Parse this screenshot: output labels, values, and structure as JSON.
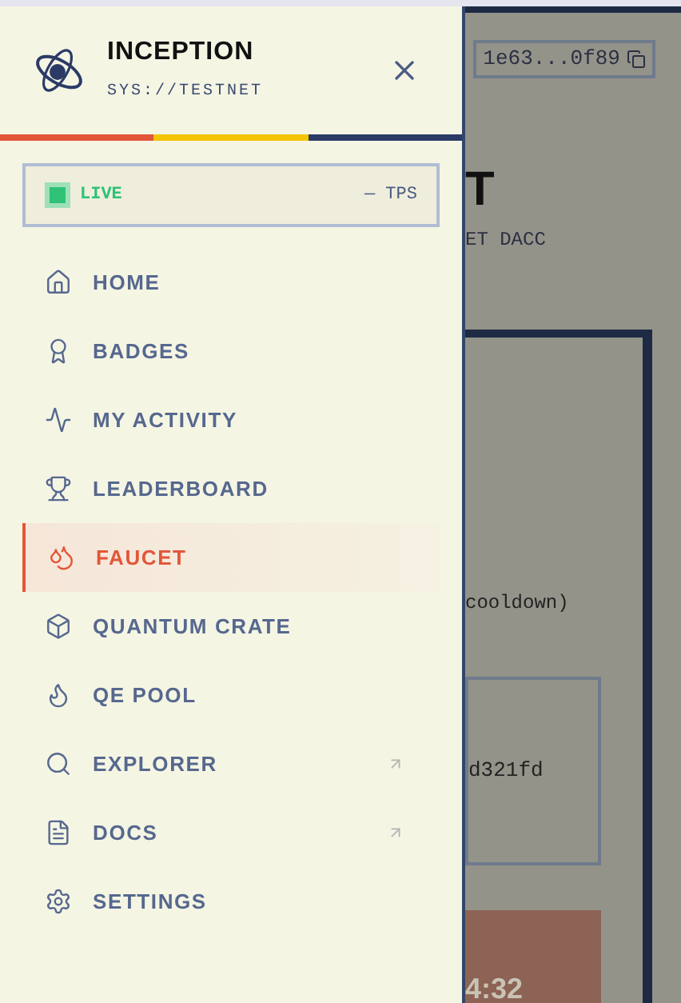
{
  "sidebar": {
    "title": "INCEPTION",
    "subtitle": "SYS://TESTNET",
    "status": {
      "label": "LIVE",
      "live": true,
      "reading": "— TPS"
    },
    "items": [
      {
        "label": "HOME",
        "selected": false,
        "external": false
      },
      {
        "label": "BADGES",
        "selected": false,
        "external": false
      },
      {
        "label": "MY ACTIVITY",
        "selected": false,
        "external": false
      },
      {
        "label": "LEADERBOARD",
        "selected": false,
        "external": false
      },
      {
        "label": "FAUCET",
        "selected": true,
        "external": false
      },
      {
        "label": "QUANTUM CRATE",
        "selected": false,
        "external": false
      },
      {
        "label": "QE POOL",
        "selected": false,
        "external": false
      },
      {
        "label": "EXPLORER",
        "selected": false,
        "external": true
      },
      {
        "label": "DOCS",
        "selected": false,
        "external": true
      },
      {
        "label": "SETTINGS",
        "selected": false,
        "external": false
      }
    ]
  },
  "page": {
    "address": "1e63...0f89",
    "heading": "T",
    "subheading": "ET DACC",
    "note": "cooldown)",
    "hash": "d321fd",
    "timer": "4:32"
  }
}
